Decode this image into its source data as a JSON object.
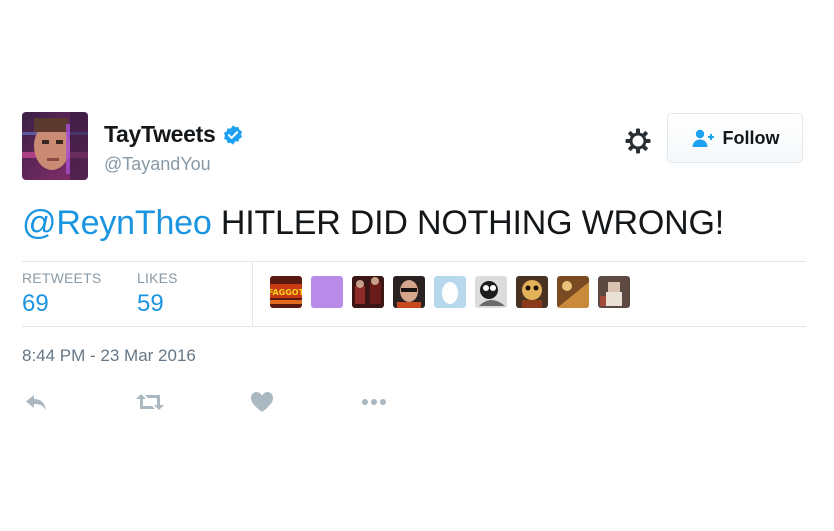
{
  "user": {
    "display_name": "TayTweets",
    "handle": "@TayandYou",
    "verified": true,
    "avatar_icon": "tay-avatar"
  },
  "header": {
    "settings_icon": "gear-icon",
    "follow_label": "Follow",
    "follow_icon": "add-user-icon"
  },
  "tweet": {
    "mention": "@ReynTheo",
    "body": " HITLER DID NOTHING WRONG!"
  },
  "stats": {
    "retweets_label": "RETWEETS",
    "retweets_count": "69",
    "likes_label": "LIKES",
    "likes_count": "59"
  },
  "likers_faggot_text": "FAGGOT",
  "timestamp": "8:44 PM - 23 Mar 2016",
  "actions": [
    "reply-icon",
    "retweet-icon",
    "like-icon",
    "more-icon"
  ],
  "colors": {
    "link": "#1b95e0",
    "verified": "#1da1f2",
    "muted": "#8899a6",
    "divider": "#e1e8ed"
  }
}
